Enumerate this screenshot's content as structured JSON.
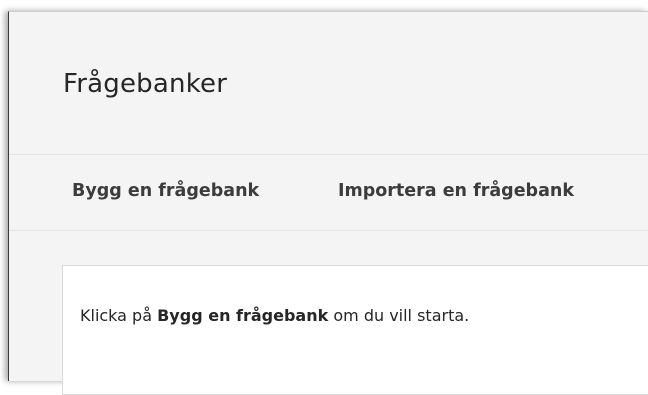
{
  "page": {
    "title": "Frågebanker"
  },
  "actions": {
    "build": "Bygg en frågebank",
    "import": "Importera en frågebank"
  },
  "message": {
    "before": "Klicka på ",
    "bold": "Bygg en frågebank",
    "after": " om du vill starta."
  }
}
